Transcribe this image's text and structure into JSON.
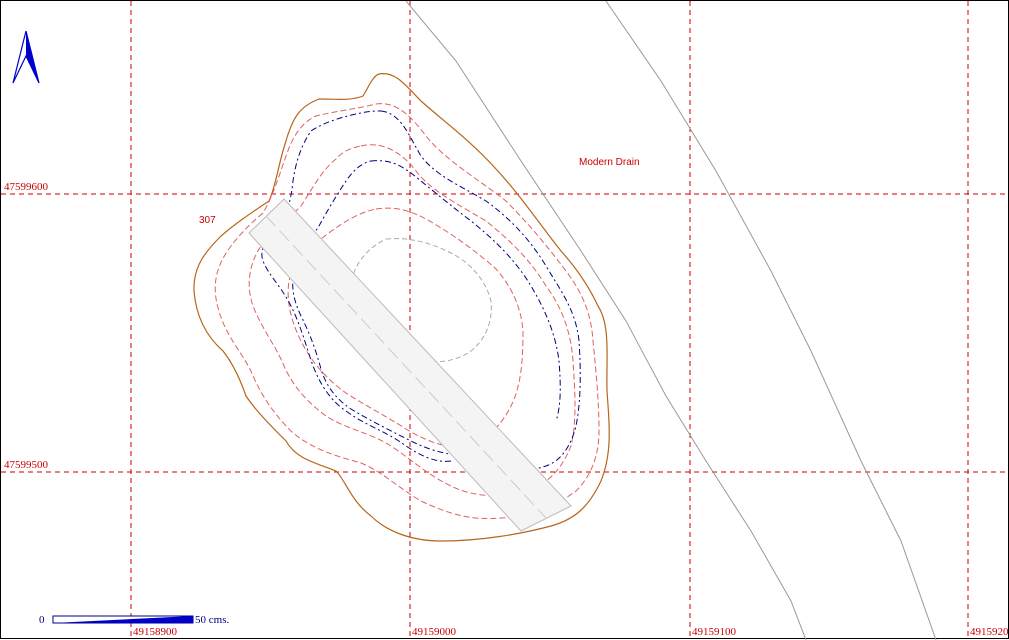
{
  "grid": {
    "easting_labels": [
      "49158900",
      "49159000",
      "49159100",
      "4915920"
    ],
    "northing_labels": [
      "47599600",
      "47599500"
    ]
  },
  "labels": {
    "feature_number": "307",
    "modern_drain": "Modern Drain"
  },
  "scale_bar": {
    "start": "0",
    "end": "50 cms."
  },
  "north_arrow": {
    "icon": "north-arrow-icon"
  },
  "colors": {
    "grid": "#cc0000",
    "outer_contour": "#b8651b",
    "contour_red": "#e06060",
    "contour_blue": "#000080",
    "contour_grey": "#aaaaaa",
    "drain": "#999999"
  }
}
